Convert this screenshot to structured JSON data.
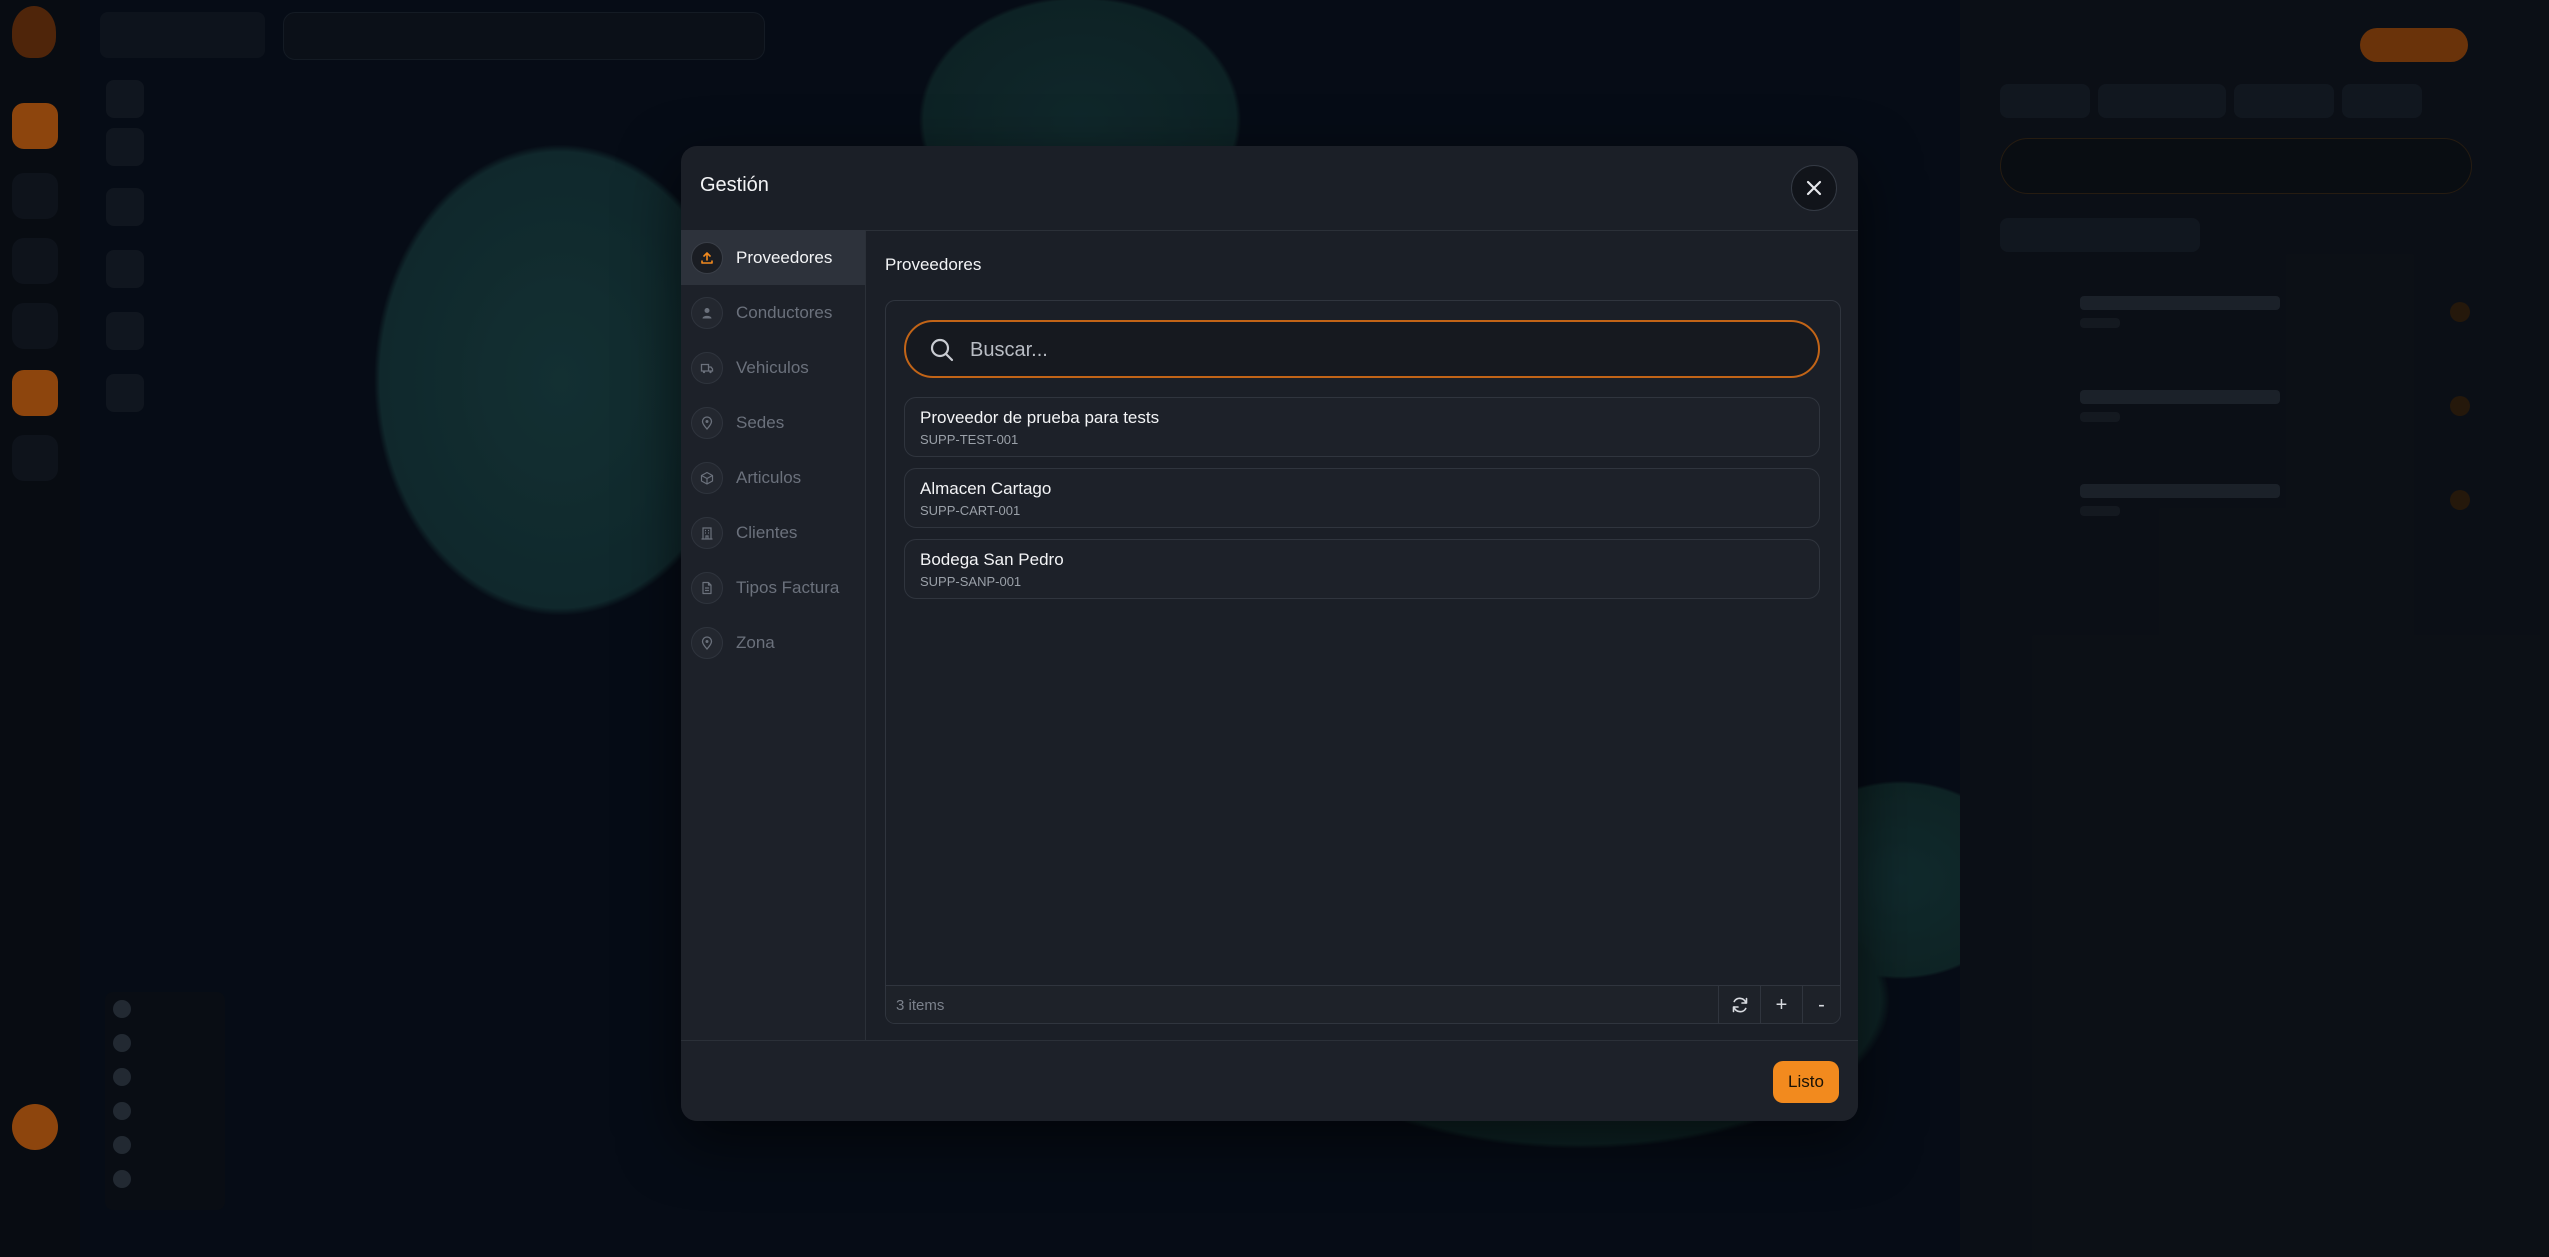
{
  "modal": {
    "title": "Gestión",
    "nav": [
      {
        "label": "Proveedores",
        "icon": "upload-icon",
        "active": true
      },
      {
        "label": "Conductores",
        "icon": "user-icon"
      },
      {
        "label": "Vehiculos",
        "icon": "truck-icon"
      },
      {
        "label": "Sedes",
        "icon": "location-pin-icon"
      },
      {
        "label": "Articulos",
        "icon": "box-icon"
      },
      {
        "label": "Clientes",
        "icon": "building-icon"
      },
      {
        "label": "Tipos Factura",
        "icon": "document-icon"
      },
      {
        "label": "Zona",
        "icon": "location-pin-icon"
      }
    ],
    "section_title": "Proveedores",
    "search": {
      "placeholder": "Buscar...",
      "value": ""
    },
    "items": [
      {
        "name": "Proveedor de prueba para tests",
        "code": "SUPP-TEST-001"
      },
      {
        "name": "Almacen Cartago",
        "code": "SUPP-CART-001"
      },
      {
        "name": "Bodega San Pedro",
        "code": "SUPP-SANP-001"
      }
    ],
    "items_count": "3 items",
    "footer_buttons": {
      "add": "+",
      "remove": "-"
    },
    "done_label": "Listo"
  },
  "colors": {
    "accent": "#f28a1e",
    "modal_bg": "#1b1f27",
    "search_border": "#c26417"
  }
}
